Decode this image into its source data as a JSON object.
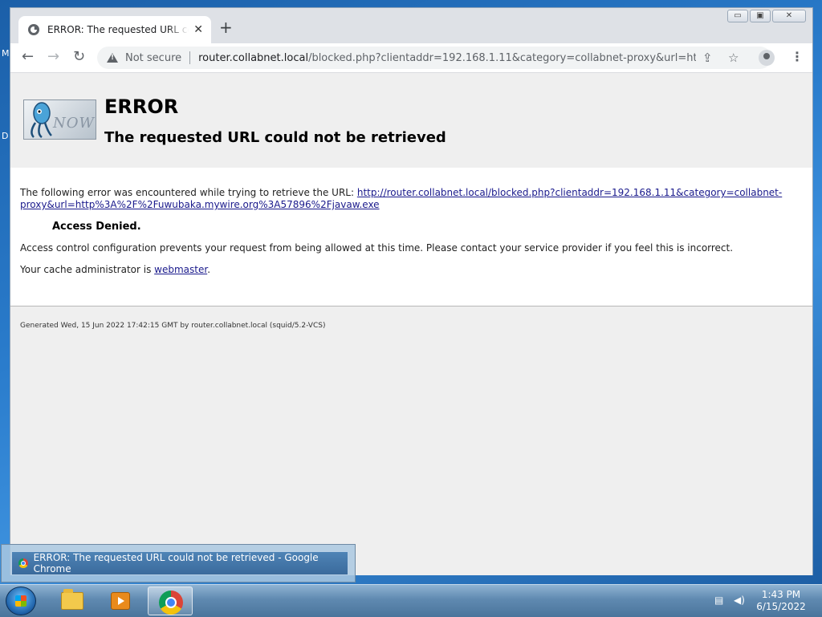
{
  "desktop": {
    "left_labels": [
      "M",
      "D"
    ]
  },
  "window": {
    "controls": {
      "minimize": "▭",
      "maximize": "▣",
      "close": "✕"
    }
  },
  "browser": {
    "tab": {
      "title": "ERROR: The requested URL could not be retrieved",
      "close": "✕"
    },
    "new_tab": "+",
    "nav": {
      "back": "←",
      "forward": "→",
      "reload": "↻"
    },
    "omnibox": {
      "security_label": "Not secure",
      "url_host": "router.collabnet.local",
      "url_path": "/blocked.php?clientaddr=192.168.1.11&category=collabnet-proxy&url=http%..."
    },
    "icons": {
      "share": "⇪",
      "bookmark": "☆",
      "menu": "⋮"
    }
  },
  "page": {
    "logo_text": "NOW",
    "title": "ERROR",
    "subtitle": "The requested URL could not be retrieved",
    "intro_text": "The following error was encountered while trying to retrieve the URL: ",
    "error_url_line1": "http://router.collabnet.local/blocked.php?clientaddr=192.168.1.11&category=collabnet-",
    "error_url_line2": "proxy&url=http%3A%2F%2Fuwubaka.mywire.org%3A57896%2Fjavaw.exe",
    "denied": "Access Denied.",
    "explanation": "Access control configuration prevents your request from being allowed at this time. Please contact your service provider if you feel this is incorrect.",
    "admin_prefix": "Your cache administrator is ",
    "admin_link": "webmaster",
    "admin_suffix": ".",
    "footer": "Generated Wed, 15 Jun 2022 17:42:15 GMT by router.collabnet.local (squid/5.2-VCS)"
  },
  "taskbar": {
    "tooltip": "ERROR: The requested URL could not be retrieved - Google Chrome",
    "clock_time": "1:43 PM",
    "clock_date": "6/15/2022"
  }
}
